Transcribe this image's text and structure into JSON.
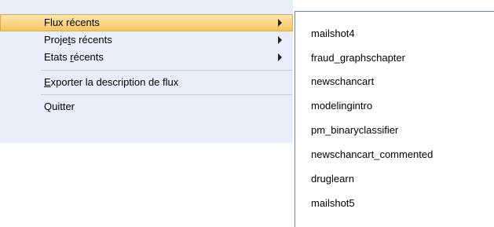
{
  "main_menu": {
    "items": [
      {
        "label": "Flux récents",
        "has_submenu": true,
        "selected": true
      },
      {
        "label_pre": "Proje",
        "label_ul": "t",
        "label_post": "s récents",
        "has_submenu": true
      },
      {
        "label_pre": "Etats ",
        "label_ul": "r",
        "label_post": "écents",
        "has_submenu": true
      },
      {
        "label_pre": "",
        "label_ul": "E",
        "label_post": "xporter la description de flux",
        "has_submenu": false
      },
      {
        "label": "Quitter",
        "has_submenu": false
      }
    ]
  },
  "submenu": {
    "items": [
      "mailshot4",
      "fraud_graphschapter",
      "newschancart",
      "modelingintro",
      "pm_binaryclassifier",
      "newschancart_commented",
      "druglearn",
      "mailshot5"
    ]
  },
  "colors": {
    "menu_background": "#e7eef9",
    "selected_gradient_top": "#fde7b0",
    "selected_gradient_bottom": "#f7c460",
    "selected_border": "#e5aa3f",
    "submenu_border": "#5a86b8"
  }
}
